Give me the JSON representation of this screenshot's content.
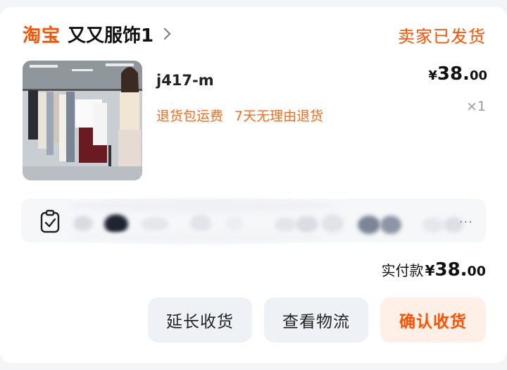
{
  "shop": {
    "platform": "淘宝",
    "name": "又又服饰1"
  },
  "order": {
    "status": "卖家已发货"
  },
  "product": {
    "title": "j417-m",
    "price_symbol": "¥",
    "price_int": "38.",
    "price_dec": "00",
    "quantity": "×1",
    "tags": [
      "退货包运费",
      "7天无理由退货"
    ]
  },
  "logistics": {
    "more": "..."
  },
  "payment": {
    "label": "实付款",
    "symbol": "¥",
    "int": "38.",
    "dec": "00"
  },
  "actions": {
    "extend": "延长收货",
    "view_logistics": "查看物流",
    "confirm": "确认收货"
  },
  "colors": {
    "accent": "#ff5000",
    "tag": "#ff6a1a",
    "button_bg": "#eef1f5",
    "confirm_bg": "#fff0e7"
  }
}
